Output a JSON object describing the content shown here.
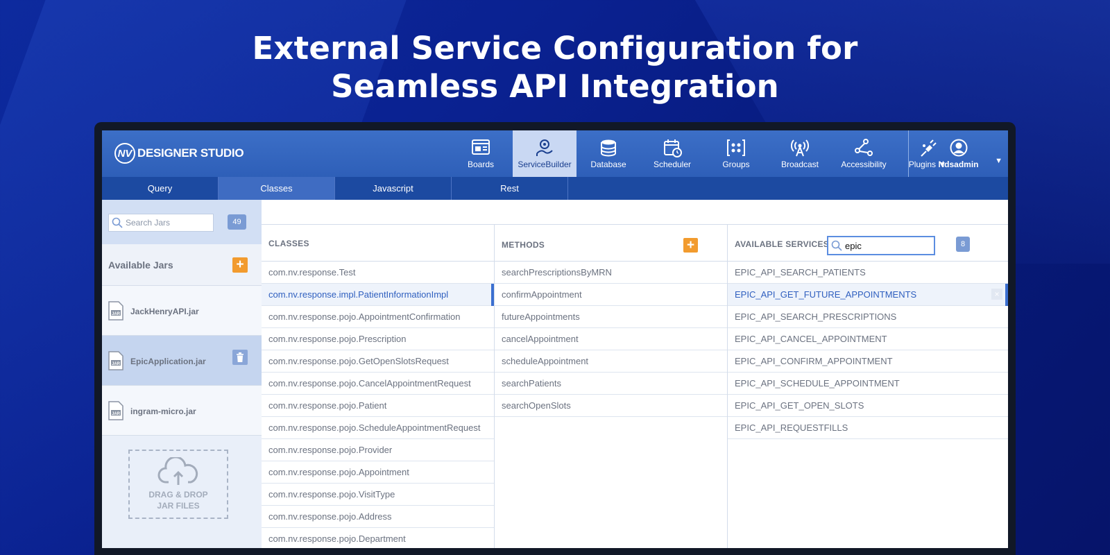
{
  "headline": {
    "line1": "External Service Configuration for",
    "line2": "Seamless API Integration"
  },
  "app": {
    "logo_mark": "NV",
    "logo_text": "DESIGNER STUDIO"
  },
  "nav": {
    "items": [
      {
        "label": "Boards",
        "icon": "boards-icon"
      },
      {
        "label": "ServiceBuilder",
        "icon": "service-builder-icon",
        "active": true
      },
      {
        "label": "Database",
        "icon": "database-icon"
      },
      {
        "label": "Scheduler",
        "icon": "calendar-icon"
      },
      {
        "label": "Groups",
        "icon": "groups-icon"
      },
      {
        "label": "Broadcast",
        "icon": "broadcast-icon"
      },
      {
        "label": "Accessibility",
        "icon": "share-nodes-icon"
      },
      {
        "label": "Plugins ▼",
        "icon": "plug-icon"
      }
    ],
    "user": "Ndsadmin",
    "user_caret": "▼"
  },
  "subtabs": [
    "Query",
    "Classes",
    "Javascript",
    "Rest"
  ],
  "left": {
    "search_placeholder": "Search Jars",
    "jar_count": "49",
    "available_jars_title": "Available Jars",
    "jars": [
      "JackHenryAPI.jar",
      "EpicApplication.jar",
      "ingram-micro.jar"
    ],
    "drop_line1": "DRAG & DROP",
    "drop_line2": "JAR FILES"
  },
  "classes": {
    "title": "CLASSES",
    "items": [
      "com.nv.response.Test",
      "com.nv.response.impl.PatientInformationImpl",
      "com.nv.response.pojo.AppointmentConfirmation",
      "com.nv.response.pojo.Prescription",
      "com.nv.response.pojo.GetOpenSlotsRequest",
      "com.nv.response.pojo.CancelAppointmentRequest",
      "com.nv.response.pojo.Patient",
      "com.nv.response.pojo.ScheduleAppointmentRequest",
      "com.nv.response.pojo.Provider",
      "com.nv.response.pojo.Appointment",
      "com.nv.response.pojo.VisitType",
      "com.nv.response.pojo.Address",
      "com.nv.response.pojo.Department"
    ],
    "selected_index": 1
  },
  "methods": {
    "title": "METHODS",
    "items": [
      "searchPrescriptionsByMRN",
      "confirmAppointment",
      "futureAppointments",
      "cancelAppointment",
      "scheduleAppointment",
      "searchPatients",
      "searchOpenSlots"
    ]
  },
  "services": {
    "title": "AVAILABLE SERVICES",
    "search_value": "epic",
    "count": "8",
    "items": [
      "EPIC_API_SEARCH_PATIENTS",
      "EPIC_API_GET_FUTURE_APPOINTMENTS",
      "EPIC_API_SEARCH_PRESCRIPTIONS",
      "EPIC_API_CANCEL_APPOINTMENT",
      "EPIC_API_CONFIRM_APPOINTMENT",
      "EPIC_API_SCHEDULE_APPOINTMENT",
      "EPIC_API_GET_OPEN_SLOTS",
      "EPIC_API_REQUESTFILLS"
    ],
    "selected_index": 1,
    "clear_glyph": "×"
  },
  "colors": {
    "accent": "#f29b2e",
    "brand_blue": "#2e5fb8",
    "selected_text": "#2f5fbf"
  }
}
